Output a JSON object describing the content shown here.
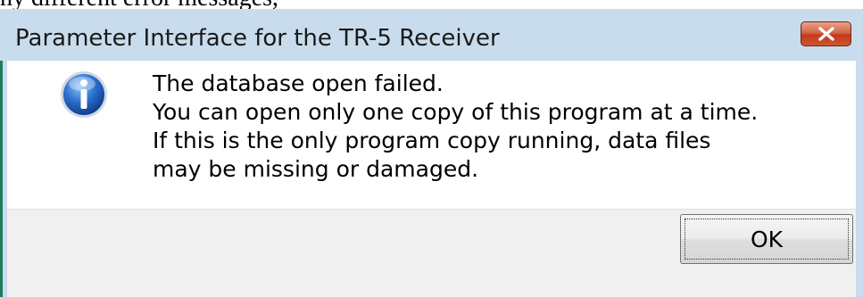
{
  "background": {
    "caption": "ny different error messages,"
  },
  "dialog": {
    "title": "Parameter Interface for the TR-5 Receiver",
    "close_icon": "close-icon",
    "icon": "info-icon",
    "message_lines": [
      "The database open failed.",
      "You can open only one copy of this program at a time.",
      "If this is the only program copy running, data files",
      "may be missing or damaged."
    ],
    "ok_label": "OK"
  },
  "colors": {
    "titlebar": "#c9dced",
    "close_button": "#c23a1a",
    "footer": "#f0f0f0",
    "info_icon": "#1e5fb4"
  }
}
